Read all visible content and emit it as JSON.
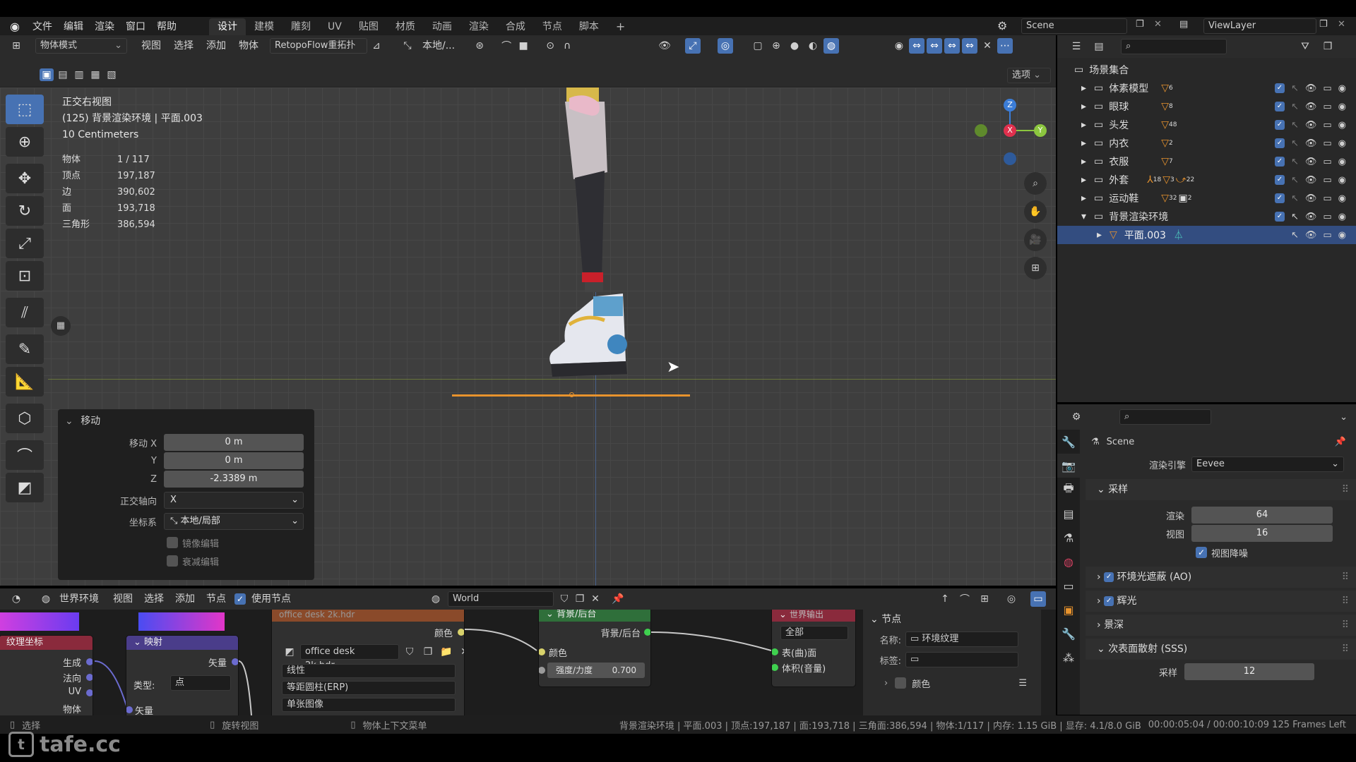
{
  "menubar": {
    "menus": [
      "文件",
      "编辑",
      "渲染",
      "窗口",
      "帮助"
    ],
    "workspaces": [
      "设计",
      "建模",
      "雕刻",
      "UV",
      "贴图",
      "材质",
      "动画",
      "渲染",
      "合成",
      "节点",
      "脚本"
    ],
    "active_workspace": "设计",
    "add_tab": "+",
    "scene": "Scene",
    "view_layer": "ViewLayer"
  },
  "viewport_header": {
    "mode": "物体模式",
    "menus": [
      "视图",
      "选择",
      "添加",
      "物体"
    ],
    "addon": "RetopoFlow重拓扑",
    "transform_orientation": "本地/...",
    "options": "选项"
  },
  "viewport": {
    "view_name": "正交右视图",
    "collection_info": "(125) 背景渲染环境 | 平面.003",
    "scale": "10 Centimeters",
    "stats": [
      {
        "k": "物体",
        "v": "1 / 117"
      },
      {
        "k": "顶点",
        "v": "197,187"
      },
      {
        "k": "边",
        "v": "390,602"
      },
      {
        "k": "面",
        "v": "193,718"
      },
      {
        "k": "三角形",
        "v": "386,594"
      }
    ],
    "gizmo": {
      "z": "Z",
      "x": "X",
      "y": "Y"
    }
  },
  "operator": {
    "title": "移动",
    "move_x_label": "移动 X",
    "move_x": "0 m",
    "move_y_label": "Y",
    "move_y": "0 m",
    "move_z_label": "Z",
    "move_z": "-2.3389 m",
    "axis_label": "正交轴向",
    "axis": "X",
    "coord_label": "坐标系",
    "coord": "本地/局部",
    "mirror": "镜像编辑",
    "falloff": "衰减编辑"
  },
  "node_header": {
    "world_env": "世界环境",
    "menus": [
      "视图",
      "选择",
      "添加",
      "节点"
    ],
    "use_nodes": "使用节点",
    "world": "World"
  },
  "nodes": {
    "texcoord_title": "纹理坐标",
    "texcoord_outputs": [
      "生成",
      "法向",
      "UV",
      "物体"
    ],
    "mapping_title": "映射",
    "mapping_type_label": "类型:",
    "mapping_type": "点",
    "mapping_vector_out": "矢量",
    "mapping_vector_in": "矢量",
    "env_title": "office desk 2k.hdr",
    "env_color": "颜色",
    "env_image": "office desk 2k.hdr...",
    "env_interp": "线性",
    "env_proj": "等距圆柱(ERP)",
    "env_ext": "单张图像",
    "bg_title": "背景/后台",
    "bg_out": "背景/后台",
    "bg_color": "颜色",
    "bg_strength_label": "强度/力度",
    "bg_strength": "0.700",
    "out_title": "世界输出",
    "out_target": "全部",
    "out_surface": "表(曲)面",
    "out_volume": "体积(音量)",
    "side_title": "节点",
    "side_name_label": "名称:",
    "side_name": "环境纹理",
    "side_label_label": "标签:",
    "side_color": "颜色"
  },
  "outliner": {
    "root": "场景集合",
    "items": [
      {
        "name": "体素模型",
        "badge": "6"
      },
      {
        "name": "眼球",
        "badge": "8"
      },
      {
        "name": "头发",
        "badge": "48"
      },
      {
        "name": "内衣",
        "badge": "2"
      },
      {
        "name": "衣服",
        "badge": "7"
      },
      {
        "name": "外套",
        "badge": "18",
        "badge2": "3",
        "badge3": "22"
      },
      {
        "name": "运动鞋",
        "badge": "32",
        "badge2": "2"
      },
      {
        "name": "背景渲染环境",
        "badge": ""
      }
    ],
    "child": "平面.003"
  },
  "properties": {
    "scene": "Scene",
    "engine_label": "渲染引擎",
    "engine": "Eevee",
    "sampling": "采样",
    "render_label": "渲染",
    "render_val": "64",
    "viewport_label": "视图",
    "viewport_val": "16",
    "denoise": "视图降噪",
    "ao": "环境光遮蔽 (AO)",
    "bloom": "辉光",
    "dof": "景深",
    "sss": "次表面散射 (SSS)",
    "sss_samples_label": "采样",
    "sss_samples": "12"
  },
  "statusbar": {
    "select": "选择",
    "rotate": "旋转视图",
    "context": "物体上下文菜单",
    "info": "背景渲染环境 | 平面.003 | 顶点:197,187 | 面:193,718 | 三角面:386,594 | 物体:1/117 | 内存: 1.15 GiB | 显存: 4.1/8.0 GiB",
    "time": "00:00:05:04 / 00:00:10:09 125 Frames Left"
  },
  "watermark": "tafe.cc",
  "colors": {
    "accent": "#4772b3",
    "selected_row": "#334d80",
    "axis_x": "#e0304d",
    "axis_y": "#8cc63f",
    "axis_z": "#3b7dd8",
    "floor_line": "#e8932d"
  }
}
